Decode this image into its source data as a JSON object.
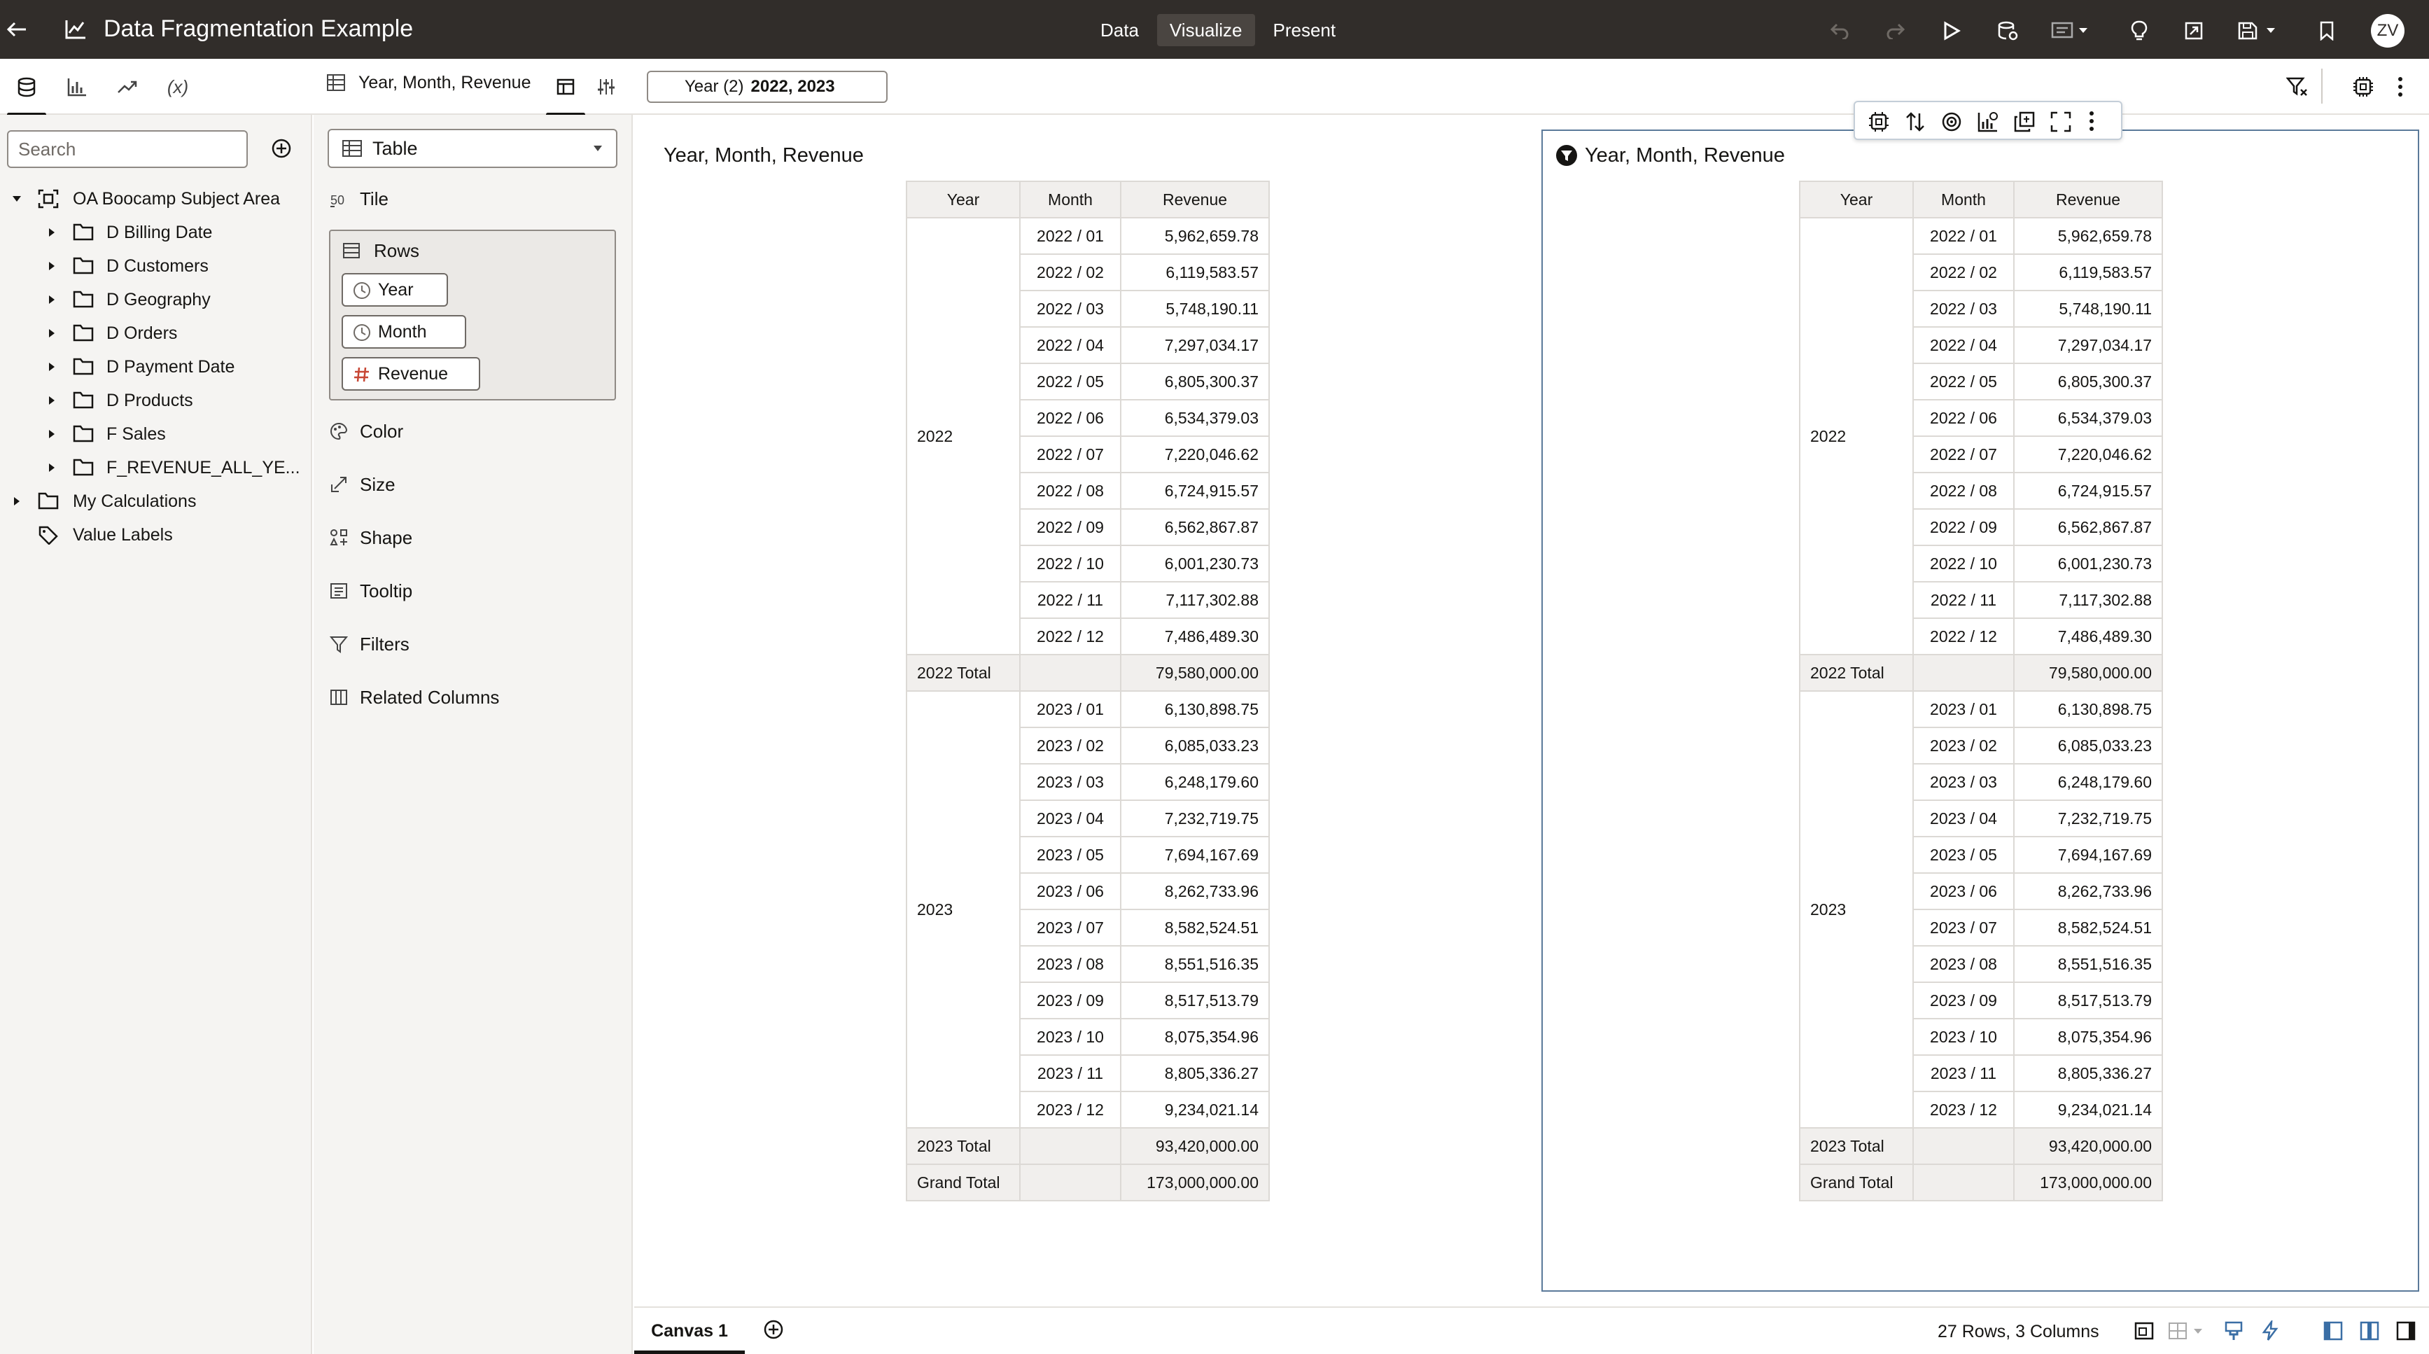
{
  "app": {
    "title": "Data Fragmentation Example",
    "user_initials": "ZV"
  },
  "modes": [
    "Data",
    "Visualize",
    "Present"
  ],
  "active_mode": "Visualize",
  "toolbar_icons": [
    "undo-icon",
    "redo-icon",
    "play-icon",
    "refresh-data-icon",
    "narrate-icon",
    "insights-icon",
    "export-icon",
    "save-icon",
    "bookmark-icon"
  ],
  "subbar": {
    "viz_title": "Year, Month, Revenue",
    "filter": {
      "label": "Year (2)",
      "value": "2022, 2023"
    }
  },
  "data_panel": {
    "search_placeholder": "Search",
    "tree": [
      {
        "label": "OA Boocamp Subject Area",
        "type": "subject-area",
        "expanded": true,
        "level": 0
      },
      {
        "label": "D Billing Date",
        "type": "folder",
        "level": 1
      },
      {
        "label": "D Customers",
        "type": "folder",
        "level": 1
      },
      {
        "label": "D Geography",
        "type": "folder",
        "level": 1
      },
      {
        "label": "D Orders",
        "type": "folder",
        "level": 1
      },
      {
        "label": "D Payment Date",
        "type": "folder",
        "level": 1
      },
      {
        "label": "D Products",
        "type": "folder",
        "level": 1
      },
      {
        "label": "F Sales",
        "type": "folder",
        "level": 1
      },
      {
        "label": "F_REVENUE_ALL_YE...",
        "type": "folder",
        "level": 1
      },
      {
        "label": "My Calculations",
        "type": "folder",
        "level": 0
      },
      {
        "label": "Value Labels",
        "type": "tag",
        "level": 0
      }
    ]
  },
  "grammar": {
    "viz_type": "Table",
    "tile": "Tile",
    "rows_label": "Rows",
    "row_pills": [
      {
        "label": "Year",
        "type": "time"
      },
      {
        "label": "Month",
        "type": "time"
      },
      {
        "label": "Revenue",
        "type": "measure"
      }
    ],
    "sections": [
      "Color",
      "Size",
      "Shape",
      "Tooltip",
      "Filters",
      "Related Columns"
    ]
  },
  "table": {
    "caption": "Year, Month, Revenue",
    "headers": [
      "Year",
      "Month",
      "Revenue"
    ],
    "groups": [
      {
        "year": "2022",
        "rows": [
          [
            "2022 / 01",
            "5,962,659.78"
          ],
          [
            "2022 / 02",
            "6,119,583.57"
          ],
          [
            "2022 / 03",
            "5,748,190.11"
          ],
          [
            "2022 / 04",
            "7,297,034.17"
          ],
          [
            "2022 / 05",
            "6,805,300.37"
          ],
          [
            "2022 / 06",
            "6,534,379.03"
          ],
          [
            "2022 / 07",
            "7,220,046.62"
          ],
          [
            "2022 / 08",
            "6,724,915.57"
          ],
          [
            "2022 / 09",
            "6,562,867.87"
          ],
          [
            "2022 / 10",
            "6,001,230.73"
          ],
          [
            "2022 / 11",
            "7,117,302.88"
          ],
          [
            "2022 / 12",
            "7,486,489.30"
          ]
        ],
        "total_label": "2022 Total",
        "total": "79,580,000.00"
      },
      {
        "year": "2023",
        "rows": [
          [
            "2023 / 01",
            "6,130,898.75"
          ],
          [
            "2023 / 02",
            "6,085,033.23"
          ],
          [
            "2023 / 03",
            "6,248,179.60"
          ],
          [
            "2023 / 04",
            "7,232,719.75"
          ],
          [
            "2023 / 05",
            "7,694,167.69"
          ],
          [
            "2023 / 06",
            "8,262,733.96"
          ],
          [
            "2023 / 07",
            "8,582,524.51"
          ],
          [
            "2023 / 08",
            "8,551,516.35"
          ],
          [
            "2023 / 09",
            "8,517,513.79"
          ],
          [
            "2023 / 10",
            "8,075,354.96"
          ],
          [
            "2023 / 11",
            "8,805,336.27"
          ],
          [
            "2023 / 12",
            "9,234,021.14"
          ]
        ],
        "total_label": "2023 Total",
        "total": "93,420,000.00"
      }
    ],
    "grand_total_label": "Grand Total",
    "grand_total": "173,000,000.00"
  },
  "statusbar": {
    "canvas_tab": "Canvas 1",
    "status": "27 Rows, 3 Columns"
  }
}
